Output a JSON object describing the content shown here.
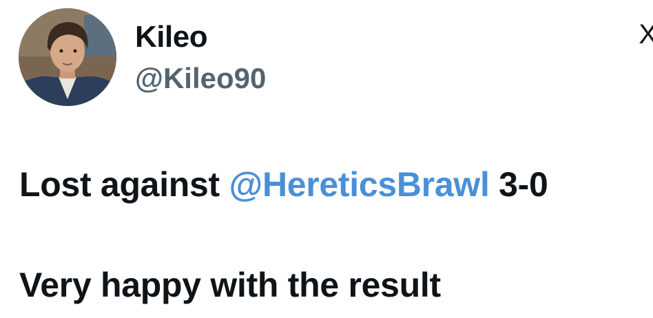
{
  "author": {
    "display_name": "Kileo",
    "handle": "@Kileo90",
    "avatar_icon": "profile-photo"
  },
  "header": {
    "more_glyph": "X",
    "more_icon": "partial-logo-icon"
  },
  "tweet": {
    "line1": {
      "before": "Lost against ",
      "mention": "@HereticsBrawl",
      "after": " 3-0"
    },
    "line2": "Very happy with the result"
  },
  "colors": {
    "text": "#0f1419",
    "handle": "#536471",
    "mention": "#4a90d8"
  }
}
